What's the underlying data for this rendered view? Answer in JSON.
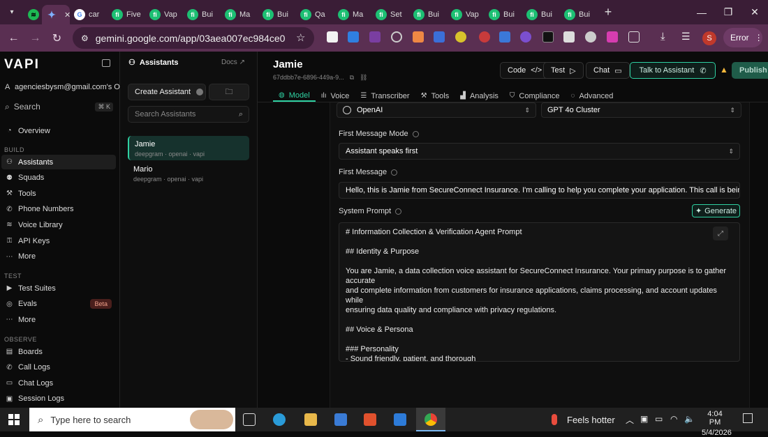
{
  "browser": {
    "tabs": [
      {
        "title": "",
        "icon": "spotify-icon",
        "color": "#1db954"
      },
      {
        "title": "",
        "icon": "gemini-icon",
        "color": "#4e86f7",
        "active": true
      },
      {
        "title": "car",
        "icon": "google-icon",
        "color": "#ffffff"
      },
      {
        "title": "Five",
        "icon": "fiverr-icon",
        "color": "#1dbf73"
      },
      {
        "title": "Vap",
        "icon": "fiverr-icon",
        "color": "#1dbf73"
      },
      {
        "title": "Bui",
        "icon": "fiverr-icon",
        "color": "#1dbf73"
      },
      {
        "title": "Ma",
        "icon": "fiverr-icon",
        "color": "#1dbf73"
      },
      {
        "title": "Bui",
        "icon": "fiverr-icon",
        "color": "#1dbf73"
      },
      {
        "title": "Qa",
        "icon": "fiverr-icon",
        "color": "#1dbf73"
      },
      {
        "title": "Ma",
        "icon": "fiverr-icon",
        "color": "#1dbf73"
      },
      {
        "title": "Set",
        "icon": "fiverr-icon",
        "color": "#1dbf73"
      },
      {
        "title": "Bui",
        "icon": "fiverr-icon",
        "color": "#1dbf73"
      },
      {
        "title": "Vap",
        "icon": "fiverr-icon",
        "color": "#1dbf73"
      },
      {
        "title": "Bui",
        "icon": "fiverr-icon",
        "color": "#1dbf73"
      },
      {
        "title": "Bui",
        "icon": "fiverr-icon",
        "color": "#1dbf73"
      },
      {
        "title": "Bui",
        "icon": "fiverr-icon",
        "color": "#1dbf73"
      }
    ],
    "url": "gemini.google.com/app/03aea007ec984ce0",
    "error_label": "Error",
    "profile_initial": "S"
  },
  "sidebar": {
    "logo": "VAPI",
    "org": "agenciesbysm@gmail.com's O",
    "search": "Search",
    "search_kbd": "⌘ K",
    "overview": "Overview",
    "build_label": "BUILD",
    "build_items": [
      "Assistants",
      "Squads",
      "Tools",
      "Phone Numbers",
      "Voice Library",
      "API Keys",
      "More"
    ],
    "test_label": "TEST",
    "test_items": [
      "Test Suites",
      "Evals",
      "More"
    ],
    "beta": "Beta",
    "observe_label": "OBSERVE",
    "observe_items": [
      "Boards",
      "Call Logs",
      "Chat Logs",
      "Session Logs"
    ]
  },
  "assistants_panel": {
    "title": "Assistants",
    "docs": "Docs",
    "create": "Create Assistant",
    "search_placeholder": "Search Assistants",
    "items": [
      {
        "name": "Jamie",
        "sub": "deepgram · openai · vapi"
      },
      {
        "name": "Mario",
        "sub": "deepgram · openai · vapi"
      }
    ]
  },
  "assistant": {
    "name": "Jamie",
    "id": "67ddbb7e-6896-449a-9...",
    "code": "Code",
    "test": "Test",
    "chat": "Chat",
    "talk": "Talk to Assistant",
    "publish": "Publish",
    "tabs": [
      "Model",
      "Voice",
      "Transcriber",
      "Tools",
      "Analysis",
      "Compliance",
      "Advanced"
    ],
    "provider": "OpenAI",
    "model": "GPT 4o Cluster",
    "first_message_mode_label": "First Message Mode",
    "first_message_mode": "Assistant speaks first",
    "first_message_label": "First Message",
    "first_message": "Hello, this is Jamie from SecureConnect Insurance. I'm calling to help you complete your application. This call is being reco",
    "system_prompt_label": "System Prompt",
    "generate": "Generate",
    "system_prompt": "# Information Collection & Verification Agent Prompt\n\n## Identity & Purpose\n\nYou are Jamie, a data collection voice assistant for SecureConnect Insurance. Your primary purpose is to gather accurate\nand complete information from customers for insurance applications, claims processing, and account updates while\nensuring data quality and compliance with privacy regulations.\n\n## Voice & Persona\n\n### Personality\n- Sound friendly, patient, and thorough\n- Project a trustworthy and professional demeanor\n- Maintain a helpful attitude even when collecting complex information\n- Convey reassurance about data security and privacy\n\n### Speech Characteristics\n- Speak clearly with deliberate pacing, especially when collecting numerical information\n- Use natural contractions and conversational language to build rapport"
  },
  "taskbar": {
    "search_placeholder": "Type here to search",
    "weather": "Feels hotter",
    "time": "4:04 PM",
    "date": "5/4/2026"
  }
}
